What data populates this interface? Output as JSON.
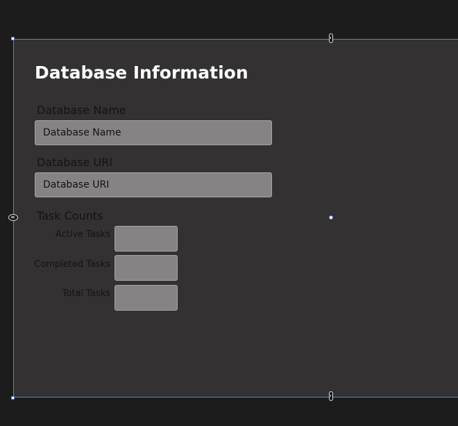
{
  "form": {
    "title": "Database Information",
    "database_name": {
      "label": "Database Name",
      "value": "",
      "placeholder": "Database Name"
    },
    "database_uri": {
      "label": "Database URI",
      "value": "",
      "placeholder": "Database URI"
    },
    "task_counts": {
      "heading": "Task Counts",
      "active": {
        "label": "Active Tasks",
        "value": ""
      },
      "completed": {
        "label": "Completed Tasks",
        "value": ""
      },
      "total": {
        "label": "Total Tasks",
        "value": ""
      }
    }
  },
  "colors": {
    "canvas_background": "#1c1c1c",
    "surface_background": "#333132",
    "selection_border": "#5b7fd6",
    "input_background": "#858383",
    "title_text": "#ffffff",
    "label_text": "#141414"
  }
}
